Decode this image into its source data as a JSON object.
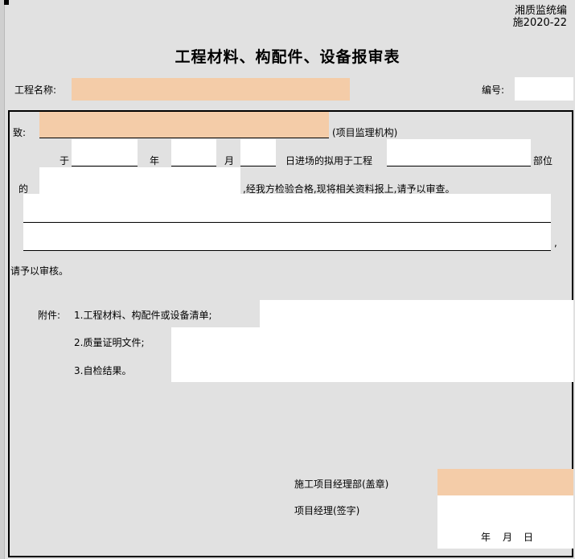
{
  "header": {
    "code_line1": "湘质监统编",
    "code_line2": "施2020-22",
    "title": "工程材料、构配件、设备报审表"
  },
  "project": {
    "name_label": "工程名称:",
    "name_value": "",
    "number_label": "编号:",
    "number_value": ""
  },
  "body": {
    "to_label": "致:",
    "to_value": "",
    "to_suffix": "(项目监理机构)",
    "on_label": "于",
    "year_label": "年",
    "month_label": "月",
    "day_text": "日进场的拟用于工程",
    "part_label": "部位",
    "of_label": "的",
    "inspection_text": ",经我方检验合格,现将相关资料报上,请予以审查。",
    "comma": ",",
    "request_text": "请予以审核。"
  },
  "attachments": {
    "label": "附件:",
    "items": [
      "1.工程材料、构配件或设备清单;",
      "2.质量证明文件;",
      "3.自检结果。"
    ]
  },
  "signature": {
    "dept_label": "施工项目经理部(盖章)",
    "manager_label": "项目经理(签字)",
    "year": "年",
    "month": "月",
    "day": "日"
  },
  "colors": {
    "fill_peach": "#f4cca8",
    "background": "#e1e1e1"
  }
}
